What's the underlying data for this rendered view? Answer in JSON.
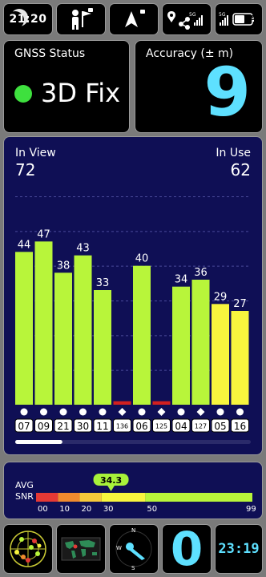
{
  "status_bar": {
    "time": "21:20",
    "icons": [
      "moon-icon",
      "person-flag-icon",
      "navigation-arrow-icon",
      "network-status-icon",
      "battery-icon"
    ],
    "battery_level": "29"
  },
  "gnss_status": {
    "label": "GNSS Status",
    "value": "3D Fix",
    "indicator_color": "#3ee03e"
  },
  "accuracy": {
    "label": "Accuracy (± m)",
    "value": "9",
    "color": "#5ee0ff"
  },
  "satellites": {
    "in_view_label": "In View",
    "in_view": "72",
    "in_use_label": "In Use",
    "in_use": "62"
  },
  "chart_data": {
    "type": "bar",
    "categories": [
      "07",
      "09",
      "21",
      "30",
      "11",
      "136",
      "06",
      "125",
      "04",
      "127",
      "05",
      "16"
    ],
    "values": [
      44,
      47,
      38,
      43,
      33,
      1,
      40,
      1,
      34,
      36,
      29,
      27
    ],
    "labels": [
      "44",
      "47",
      "38",
      "43",
      "33",
      "",
      "40",
      "",
      "34",
      "36",
      "29",
      "27"
    ],
    "colors": [
      "#b8f53a",
      "#b8f53a",
      "#b8f53a",
      "#b8f53a",
      "#b8f53a",
      "#d22020",
      "#b8f53a",
      "#d22020",
      "#b8f53a",
      "#b8f53a",
      "#f8f53e",
      "#f8f53e"
    ],
    "markers": [
      "circle",
      "circle",
      "circle",
      "circle",
      "circle",
      "diamond",
      "circle",
      "diamond",
      "circle",
      "diamond",
      "circle",
      "circle"
    ],
    "small_ids": [
      false,
      false,
      false,
      false,
      false,
      true,
      false,
      true,
      false,
      true,
      false,
      false
    ],
    "ylim": [
      0,
      60
    ],
    "grid": true,
    "scroll_position": 0.2
  },
  "snr": {
    "avg_label": "AVG",
    "snr_label": "SNR",
    "avg_value": "34.3",
    "avg_numeric": 34.3,
    "scale_min": 0,
    "scale_max": 99,
    "ticks": [
      "00",
      "10",
      "20",
      "30",
      "50",
      "99"
    ],
    "tick_values": [
      0,
      10,
      20,
      30,
      50,
      99
    ],
    "segment_colors": [
      "#e53935",
      "#f08a2e",
      "#f7c93a",
      "#f8f53e",
      "#b8f53a",
      "#5ed65e"
    ]
  },
  "bottom_bar": {
    "icons": [
      "sky-plot-icon",
      "world-map-icon",
      "compass-icon"
    ],
    "compass_letters": [
      "N",
      "W",
      "S"
    ],
    "speed_value": "0",
    "clock": "23:19"
  }
}
